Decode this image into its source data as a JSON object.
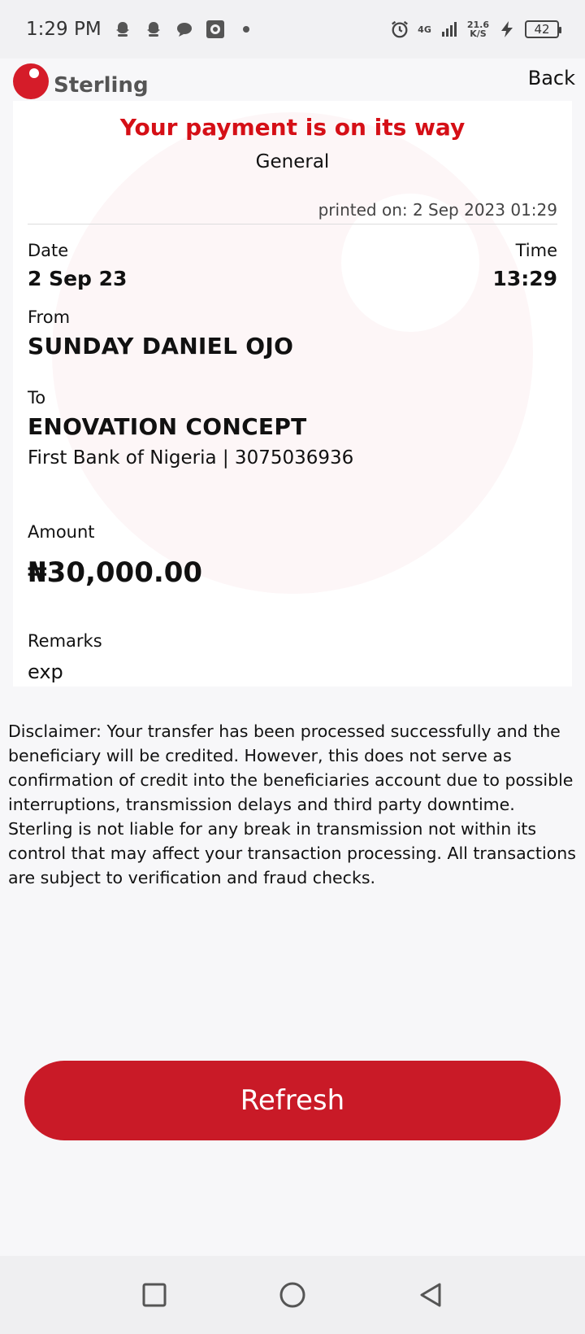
{
  "status_bar": {
    "time": "1:29 PM",
    "network": "4G",
    "speed": "21.6",
    "speed_unit": "K/S",
    "battery": "42"
  },
  "header": {
    "brand": "Sterling",
    "back_label": "Back"
  },
  "receipt": {
    "headline": "Your payment is on its way",
    "category": "General",
    "printed_on": "printed on: 2 Sep 2023 01:29",
    "date_label": "Date",
    "date_value": "2 Sep 23",
    "time_label": "Time",
    "time_value": "13:29",
    "from_label": "From",
    "from_name": "SUNDAY DANIEL OJO",
    "to_label": "To",
    "to_name": "ENOVATION CONCEPT",
    "to_bank": "First Bank of Nigeria | 3075036936",
    "amount_label": "Amount",
    "amount_value": "₦30,000.00",
    "remarks_label": "Remarks",
    "remarks_value": "exp"
  },
  "disclaimer": "Disclaimer: Your transfer has been processed successfully and the beneficiary will be credited. However, this does not serve as confirmation of credit into the beneficiaries account due to possible interruptions, transmission delays and third party downtime. Sterling is not liable for any break in transmission not within its control that may affect your transaction processing. All transactions are subject to verification and fraud checks.",
  "actions": {
    "refresh_label": "Refresh"
  },
  "colors": {
    "brand_red": "#d51c29",
    "headline_red": "#d50f16",
    "button_red": "#c91a27"
  },
  "icons": {
    "status": [
      "snapchat-icon",
      "snapchat-icon",
      "chat-icon",
      "camera-icon",
      "dot-icon",
      "alarm-icon",
      "signal-icon",
      "charging-icon",
      "battery-icon"
    ],
    "nav": [
      "recents-icon",
      "home-icon",
      "back-nav-icon"
    ]
  }
}
